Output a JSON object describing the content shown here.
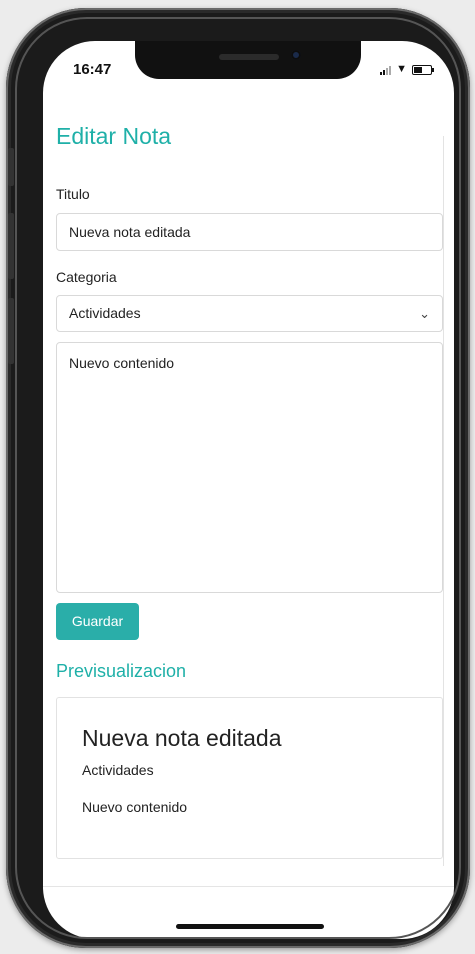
{
  "status_bar": {
    "time": "16:47"
  },
  "page": {
    "title": "Editar Nota"
  },
  "form": {
    "title_label": "Titulo",
    "title_value": "Nueva nota editada",
    "category_label": "Categoria",
    "category_selected": "Actividades",
    "content_value": "Nuevo contenido",
    "save_button": "Guardar"
  },
  "preview": {
    "heading": "Previsualizacion",
    "title": "Nueva nota editada",
    "category": "Actividades",
    "content": "Nuevo contenido"
  },
  "colors": {
    "accent": "#2aaea9",
    "heading": "#1fb0a8"
  },
  "icons": [
    "signal-icon",
    "wifi-icon",
    "battery-icon",
    "chevron-down-icon"
  ]
}
